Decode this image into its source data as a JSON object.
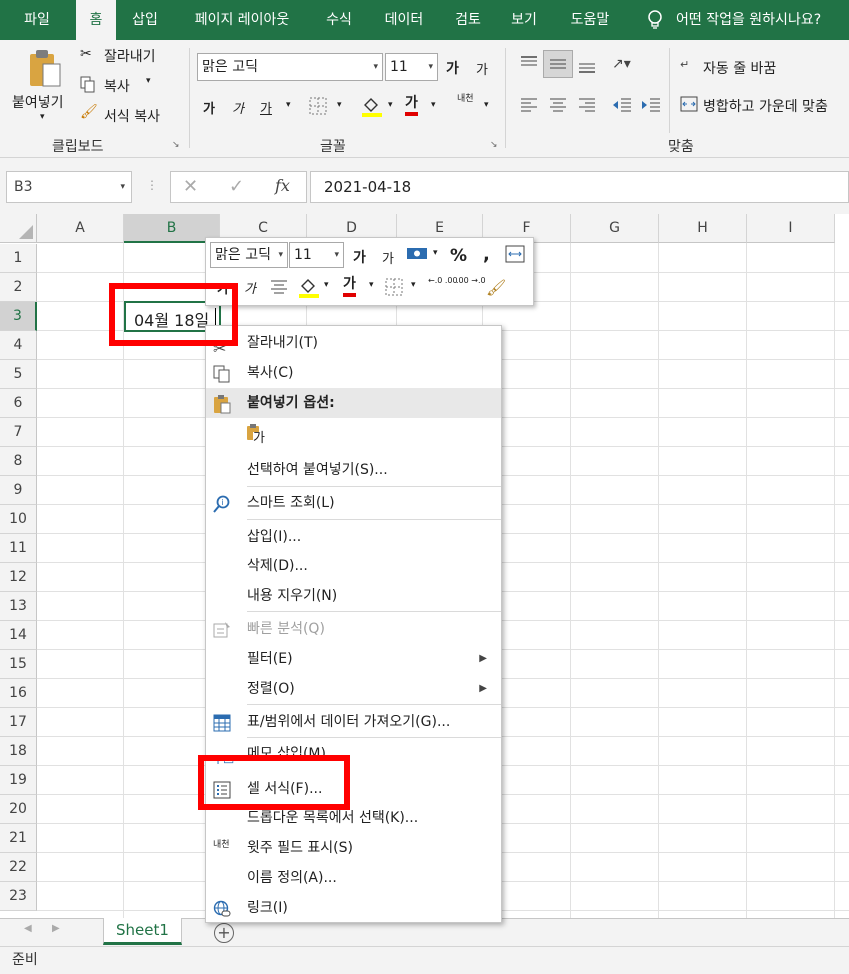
{
  "tabs": {
    "file": "파일",
    "home": "홈",
    "insert": "삽입",
    "layout": "페이지 레이아웃",
    "formulas": "수식",
    "data": "데이터",
    "review": "검토",
    "view": "보기",
    "help": "도움말",
    "tell_me": "어떤 작업을 원하시나요?"
  },
  "ribbon": {
    "paste": "붙여넣기",
    "cut": "잘라내기",
    "copy": "복사",
    "format_painter": "서식 복사",
    "clipboard": "클립보드",
    "font_name": "맑은 고딕",
    "font_size": "11",
    "grow_font": "가",
    "shrink_font": "가",
    "bold": "가",
    "italic": "가",
    "underline": "가",
    "font_color": "가",
    "phonetic": "내천",
    "font_group": "글꼴",
    "wrap_text": "자동 줄 바꿈",
    "merge_center": "병합하고 가운데 맞춤",
    "alignment_group": "맞춤"
  },
  "formula_bar": {
    "name_box": "B3",
    "formula": "2021-04-18",
    "fx": "fx"
  },
  "columns": [
    "A",
    "B",
    "C",
    "D",
    "E",
    "F",
    "G",
    "H",
    "I"
  ],
  "rows": [
    "1",
    "2",
    "3",
    "4",
    "5",
    "6",
    "7",
    "8",
    "9",
    "10",
    "11",
    "12",
    "13",
    "14",
    "15",
    "16",
    "17",
    "18",
    "19",
    "20",
    "21",
    "22",
    "23"
  ],
  "active_cell": {
    "value": "04월 18일"
  },
  "mini_toolbar": {
    "font_name": "맑은 고딕",
    "font_size": "11",
    "grow": "가",
    "shrink": "가",
    "percent": "%",
    "comma": ",",
    "bold": "가",
    "italic": "가",
    "font_color": "가",
    "inc_decimal": "←.0 .00",
    "dec_decimal": ".00 →.0"
  },
  "context_menu": {
    "cut": "잘라내기(T)",
    "copy": "복사(C)",
    "paste_options": "붙여넣기 옵션:",
    "paste_value_glyph": "가",
    "paste_special": "선택하여 붙여넣기(S)...",
    "smart_lookup": "스마트 조회(L)",
    "insert": "삽입(I)...",
    "delete": "삭제(D)...",
    "clear": "내용 지우기(N)",
    "quick_analysis": "빠른 분석(Q)",
    "filter": "필터(E)",
    "sort": "정렬(O)",
    "get_data": "표/범위에서 데이터 가져오기(G)...",
    "insert_comment": "메모 삽입(M)",
    "format_cells": "셀 서식(F)...",
    "dropdown": "드롭다운 목록에서 선택(K)...",
    "phonetic": "윗주 필드 표시(S)",
    "define_name": "이름 정의(A)...",
    "link": "링크(I)"
  },
  "sheets": {
    "active": "Sheet1"
  },
  "status": {
    "text": "준비"
  },
  "colors": {
    "accent": "#217346",
    "highlight": "#ff0000"
  }
}
